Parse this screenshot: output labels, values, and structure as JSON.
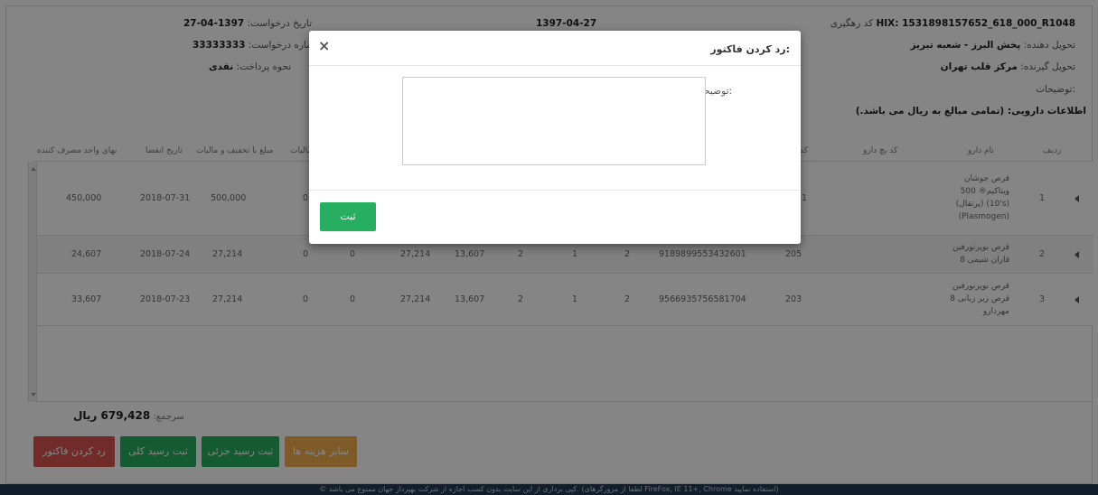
{
  "header": {
    "tracking_code_label": "کد رهگیری",
    "tracking_code_value": "HIX: 1531898157652_618_000_R1048",
    "deliverer_label": "تحویل دهنده:",
    "deliverer_value": "پخش البرز - شعبه تبریز",
    "receiver_label": "تحویل گیرنده:",
    "receiver_value": "مرکز قلب تهران",
    "notes_label": "توضیحات:",
    "drug_info_label": "اطلاعات دارویی: (تمامی مبالغ به ریال می باشد.)",
    "request_date_label": "تاریخ درخواست:",
    "request_date_value": "1397-04-27",
    "request_number_label": "شماره درخواست:",
    "request_number_value": "33333333",
    "payment_method_label": "نحوه پرداخت:",
    "payment_method_value": "نقدی",
    "invoice_date_value": "1397-04-27"
  },
  "table": {
    "columns": {
      "row": "ردیف",
      "drug_name": "نام دارو",
      "batch_code": "کد بچ دارو",
      "code": "کد",
      "tax": "مالیات",
      "amount_with_discount_tax": "مبلغ با تخفیف و مالیات",
      "expiry_date": "تاریخ انقضا",
      "consumer_unit_price": "بهای واحد مصرف کننده"
    },
    "rows": [
      {
        "row_number": "1",
        "drug_name": "قرص جوشان\nویتاکیم® 500\n(پرتقال) (10's)\n(Plasmogen)",
        "code": "1",
        "consumer_unit_price": "450,000",
        "expiry_date": "2018-07-31",
        "amount_with_discount_tax": "500,000",
        "tax": "0"
      },
      {
        "row_number": "2",
        "drug_name": "قرص بوپرنورفین\n8 فاران شیمی",
        "batch_code": "9189899553432601",
        "code": "205",
        "consumer_unit_price": "24,607",
        "expiry_date": "2018-07-24",
        "amount_with_discount_tax": "27,214",
        "tax": "0",
        "c5": "0",
        "c6": "27,214",
        "c7": "13,607",
        "c8": "2",
        "c9": "1",
        "c10": "2"
      },
      {
        "row_number": "3",
        "drug_name": "قرص بوپرنورفین\n8 قرص زیر زبانی\nمهردارو",
        "batch_code": "9566935756581704",
        "code": "203",
        "consumer_unit_price": "33,607",
        "expiry_date": "2018-07-23",
        "amount_with_discount_tax": "27,214",
        "tax": "0",
        "c5": "0",
        "c6": "27,214",
        "c7": "13,607",
        "c8": "2",
        "c9": "1",
        "c10": "2"
      }
    ]
  },
  "total": {
    "label": "سرجمع:",
    "value": "679,428 ریال"
  },
  "buttons": {
    "reject_invoice": "رد کردن فاکتور",
    "full_receipt": "ثبت رسید کلی",
    "partial_receipt": "ثبت رسید جزئی",
    "other_costs": "سایر هزینه ها"
  },
  "footer": {
    "copyright": "© کپی برداری از این سایت بدون کسب اجازه از شرکت بهپرداز جهان ممنوع می باشد. (لطفا از مرورگرهای FireFox, IE 11+, Chrome استفاده نمایید)"
  },
  "modal": {
    "title": "رد کردن فاکتور:",
    "notes_label": "توضیحات:",
    "required_mark": "*",
    "notes_value": "",
    "submit_label": "ثبت",
    "close_symbol": "×"
  },
  "colors": {
    "reject_button": "#d9534f",
    "green_button": "#27ae60",
    "other_costs_button": "#f0ad4e",
    "footer_bar": "#233a53"
  }
}
